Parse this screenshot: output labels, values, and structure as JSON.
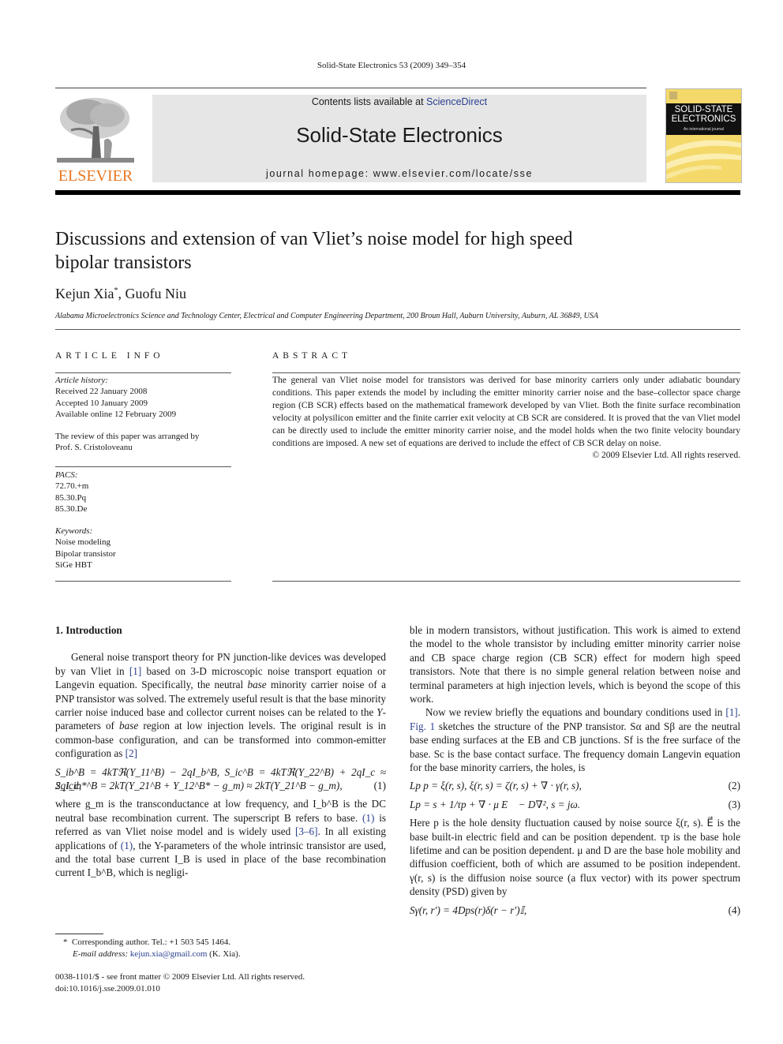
{
  "running_head": "Solid-State Electronics 53 (2009) 349–354",
  "header": {
    "publisher_logo_text": "ELSEVIER",
    "contents_prefix": "Contents lists available at ",
    "contents_link": "ScienceDirect",
    "journal_title": "Solid-State Electronics",
    "homepage_prefix": "journal homepage: ",
    "homepage_url": "www.elsevier.com/locate/sse",
    "cover_title_line1": "SOLID-STATE",
    "cover_title_line2": "ELECTRONICS",
    "cover_subtitle": "An international journal",
    "colors": {
      "publisher_orange": "#e87722",
      "band_gray": "#e6e6e6",
      "cover_yellow": "#f4d96a",
      "link_blue": "#2a3f8f"
    }
  },
  "article": {
    "title_line1": "Discussions and extension of van Vliet’s noise model for high speed",
    "title_line2": "bipolar transistors",
    "author1": "Kejun Xia",
    "author1_mark": "*",
    "author_sep": ", ",
    "author2": "Guofu Niu",
    "affiliation": "Alabama Microelectronics Science and Technology Center, Electrical and Computer Engineering Department, 200 Broun Hall, Auburn University, Auburn, AL 36849, USA"
  },
  "article_info": {
    "label": "ARTICLE INFO",
    "history_label": "Article history:",
    "history": [
      "Received 22 January 2008",
      "Accepted 10 January 2009",
      "Available online 12 February 2009"
    ],
    "review_line1": "The review of this paper was arranged by",
    "review_line2": "Prof. S. Cristoloveanu",
    "pacs_label": "PACS:",
    "pacs": [
      "72.70.+m",
      "85.30.Pq",
      "85.30.De"
    ],
    "keywords_label": "Keywords:",
    "keywords": [
      "Noise modeling",
      "Bipolar transistor",
      "SiGe HBT"
    ]
  },
  "abstract": {
    "label": "ABSTRACT",
    "text": "The general van Vliet noise model for transistors was derived for base minority carriers only under adiabatic boundary conditions. This paper extends the model by including the emitter minority carrier noise and the base–collector space charge region (CB SCR) effects based on the mathematical framework developed by van Vliet. Both the finite surface recombination velocity at polysilicon emitter and the finite carrier exit velocity at CB SCR are considered. It is proved that the van Vliet model can be directly used to include the emitter minority carrier noise, and the model holds when the two finite velocity boundary conditions are imposed. A new set of equations are derived to include the effect of CB SCR delay on noise.",
    "copyright": "© 2009 Elsevier Ltd. All rights reserved."
  },
  "body": {
    "section_heading": "1. Introduction",
    "p1_a": "General noise transport theory for PN junction-like devices was developed by van Vliet in ",
    "p1_ref1": "[1]",
    "p1_b": " based on 3-D microscopic noise transport equation or Langevin equation. Specifically, the neutral ",
    "p1_base1": "base",
    "p1_c": " minority carrier noise of a PNP transistor was solved. The extremely useful result is that the base minority carrier noise induced base and collector current noises can be related to the ",
    "p1_Y": "Y",
    "p1_d": "-parameters of ",
    "p1_base2": "base",
    "p1_e": " region at low injection levels. The original result is in common-base configuration, and can be transformed into common-emitter configuration as ",
    "p1_ref2": "[2]",
    "eq1_line1": "S_ib^B = 4kTℜ(Y_11^B) − 2qI_b^B,   S_ic^B = 4kTℜ(Y_22^B) + 2qI_c ≈ 2qI_c,",
    "eq1_line2": "S_icib*^B = 2kT(Y_21^B + Y_12^B* − g_m) ≈ 2kT(Y_21^B − g_m),",
    "eq1_num": "(1)",
    "p2_a": "where g_m is the transconductance at low frequency, and I_b^B is the DC neutral base recombination current. The superscript B refers to base. ",
    "p2_ref_eq1": "(1)",
    "p2_b": " is referred as van Vliet noise model and is widely used ",
    "p2_ref36": "[3–6]",
    "p2_c": ". In all existing applications of ",
    "p2_ref_eq1b": "(1)",
    "p2_d": ", the Y-parameters of the whole intrinsic transistor are used, and the total base current I_B is used in place of the base recombination current I_b^B, which is negligi-",
    "r1": "ble in modern transistors, without justification. This work is aimed to extend the model to the whole transistor by including emitter minority carrier noise and CB space charge region (CB SCR) effect for modern high speed transistors. Note that there is no simple general relation between noise and terminal parameters at high injection levels, which is beyond the scope of this work.",
    "r2_a": "Now we review briefly the equations and boundary conditions used in ",
    "r2_ref1": "[1]",
    "r2_sep": ". ",
    "r2_fig": "Fig. 1",
    "r2_b": " sketches the structure of the PNP transistor. Sα and Sβ are the neutral base ending surfaces at the EB and CB junctions. Sf is the free surface of the base. Sc is the base contact surface. The frequency domain Langevin equation for the base minority carriers, the holes, is",
    "eq2": "Lp p = ξ(r, s),    ξ(r, s) = ζ(r, s) + ∇ · γ(r, s),",
    "eq2_num": "(2)",
    "eq3": "Lp = s + 1/τp + ∇ · μ E⃗ − D∇²,    s = jω.",
    "eq3_num": "(3)",
    "r3": "Here p is the hole density fluctuation caused by noise source ξ(r, s). E⃗ is the base built-in electric field and can be position dependent. τp is the base hole lifetime and can be position dependent. μ and D are the base hole mobility and diffusion coefficient, both of which are assumed to be position independent. γ(r, s) is the diffusion noise source (a flux vector) with its power spectrum density (PSD) given by",
    "eq4": "Sγ(r, r′) = 4Dps(r)δ(r − r′)𝕀,",
    "eq4_num": "(4)"
  },
  "footnote": {
    "mark": "*",
    "line1": "Corresponding author. Tel.: +1 503 545 1464.",
    "email_label": "E-mail address: ",
    "email": "kejun.xia@gmail.com",
    "email_suffix": " (K. Xia)."
  },
  "bottom_meta": {
    "line1": "0038-1101/$ - see front matter © 2009 Elsevier Ltd. All rights reserved.",
    "line2": "doi:10.1016/j.sse.2009.01.010"
  }
}
